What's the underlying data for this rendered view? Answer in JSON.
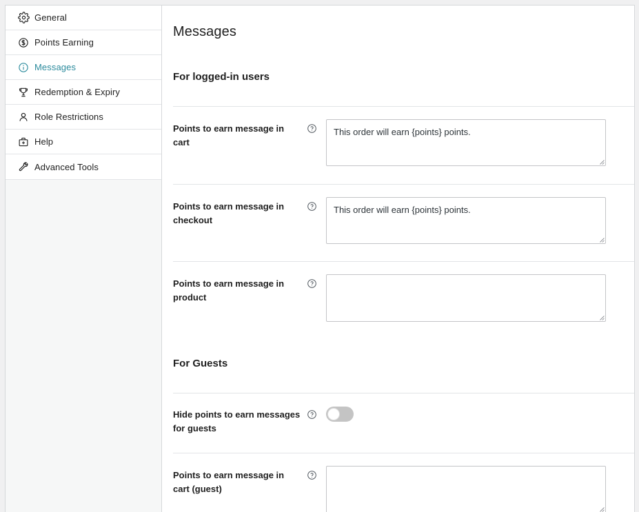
{
  "sidebar": {
    "items": [
      {
        "label": "General",
        "icon": "gear-icon",
        "active": false
      },
      {
        "label": "Points Earning",
        "icon": "dollar-coin-icon",
        "active": false
      },
      {
        "label": "Messages",
        "icon": "info-circle-icon",
        "active": true
      },
      {
        "label": "Redemption & Expiry",
        "icon": "trophy-icon",
        "active": false
      },
      {
        "label": "Role Restrictions",
        "icon": "person-icon",
        "active": false
      },
      {
        "label": "Help",
        "icon": "first-aid-kit-icon",
        "active": false
      },
      {
        "label": "Advanced Tools",
        "icon": "wrench-icon",
        "active": false
      }
    ]
  },
  "main": {
    "page_title": "Messages",
    "sections": {
      "logged_in": {
        "heading": "For logged-in users"
      },
      "guests": {
        "heading": "For Guests"
      }
    },
    "fields": {
      "cart": {
        "label": "Points to earn message in cart",
        "value": "This order will earn {points} points.",
        "placeholder": "",
        "help_icon": "help-circle-icon"
      },
      "checkout": {
        "label": "Points to earn message in checkout",
        "value": "This order will earn {points} points.",
        "placeholder": "",
        "help_icon": "help-circle-icon"
      },
      "product": {
        "label": "Points to earn message in product",
        "value": "",
        "placeholder": "",
        "help_icon": "help-circle-icon"
      },
      "hide_guests": {
        "label": "Hide points to earn messages for guests",
        "state": "off",
        "help_icon": "help-circle-icon"
      },
      "cart_guest": {
        "label": "Points to earn message in cart (guest)",
        "value": "",
        "placeholder": "",
        "help_icon": "help-circle-icon"
      }
    }
  },
  "theme": {
    "accent": "#2c8b9d",
    "text": "#1e1e1e",
    "border": "#e2e4e7",
    "input_border": "#c3c4c7",
    "sidebar_bg": "#f6f7f7",
    "toggle_off_track": "#c4c4c4"
  }
}
